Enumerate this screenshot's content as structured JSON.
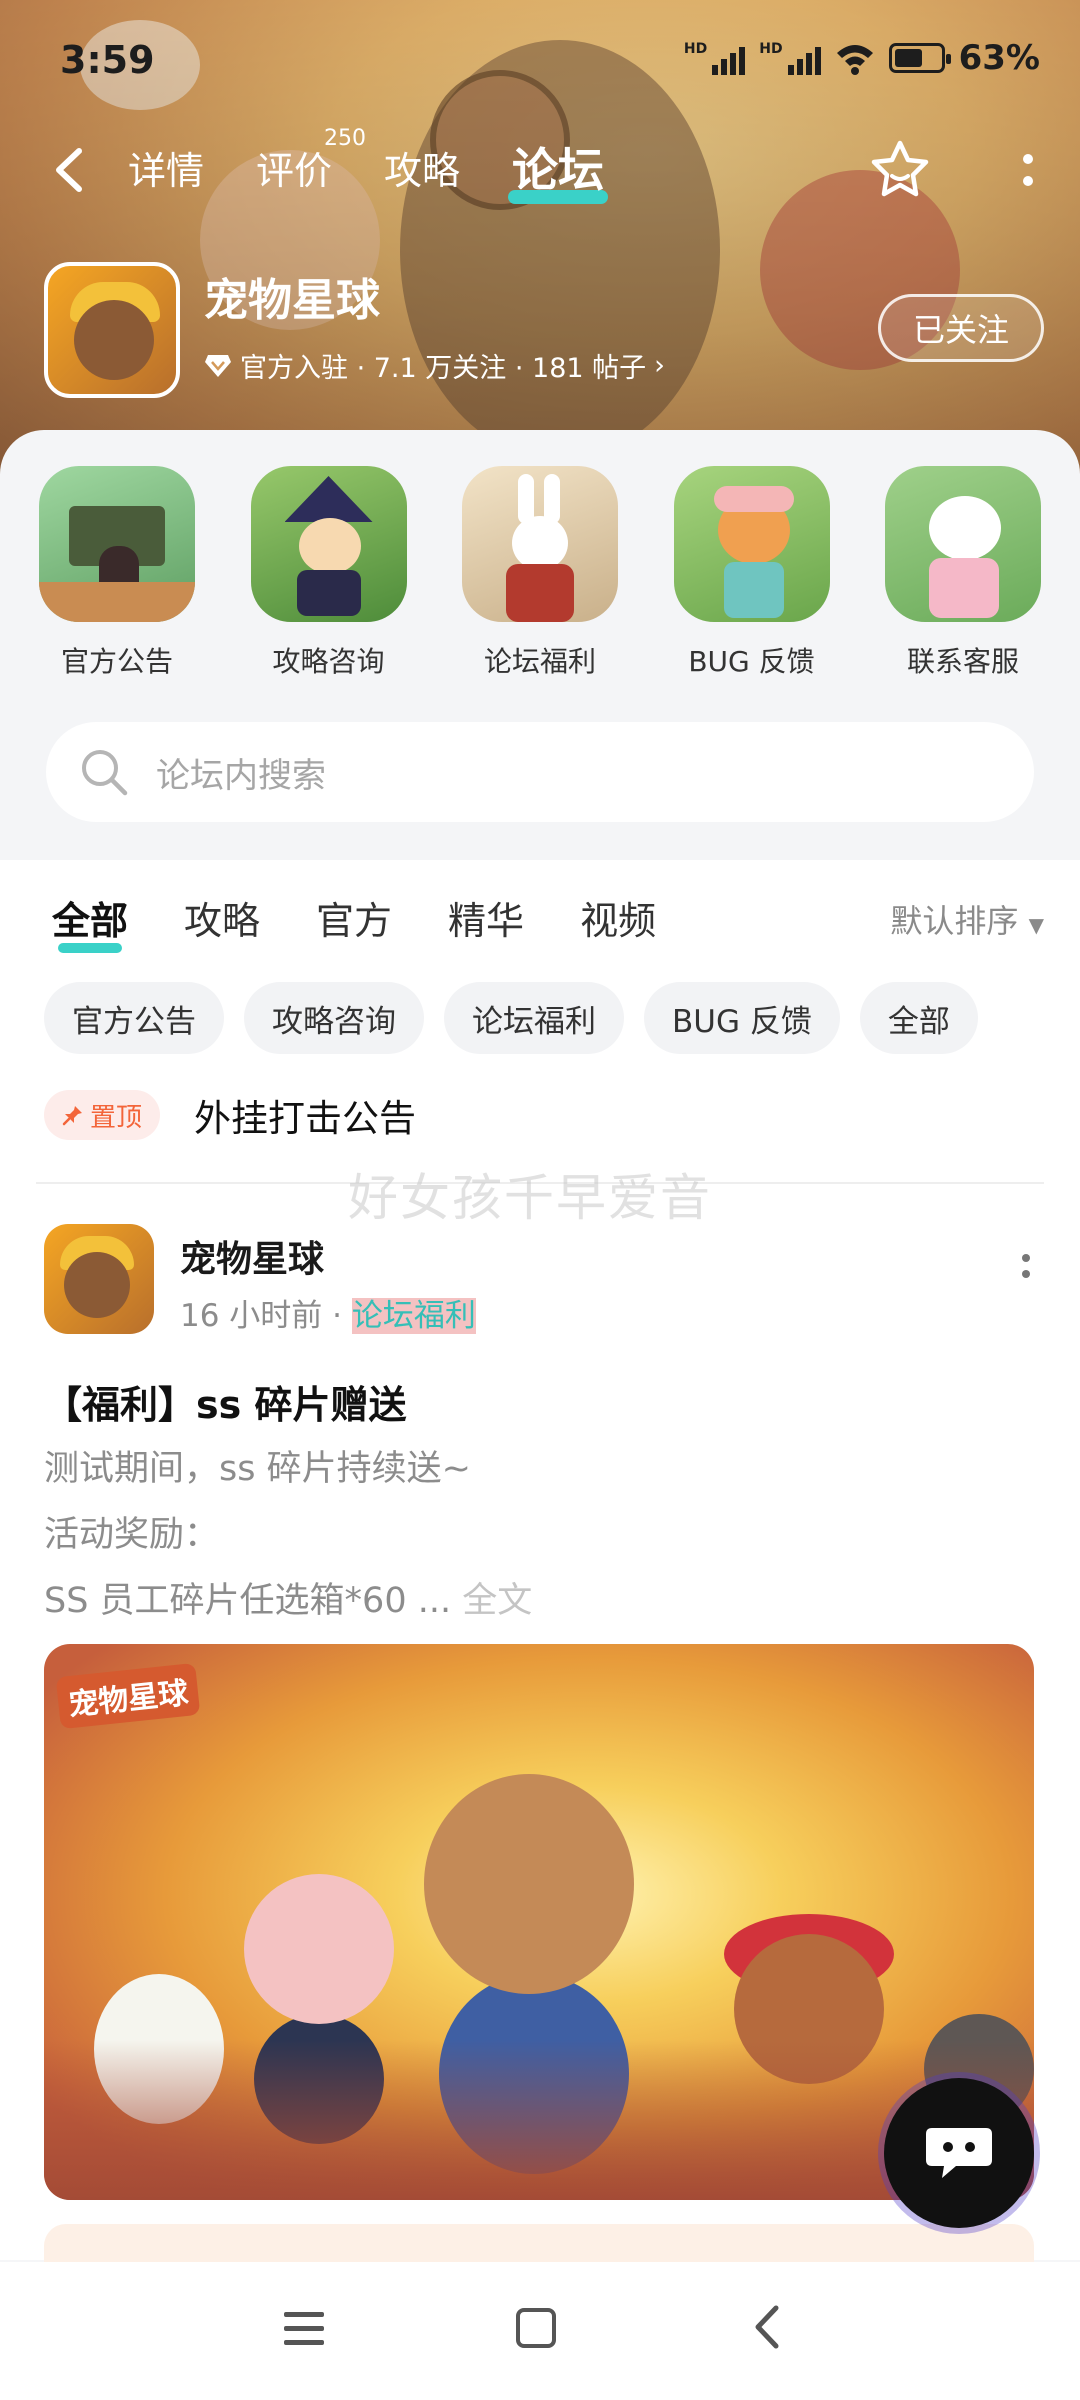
{
  "status_bar": {
    "time": "3:59",
    "battery": "63%"
  },
  "nav": {
    "tabs": [
      {
        "label": "详情"
      },
      {
        "label": "评价",
        "badge": "250"
      },
      {
        "label": "攻略"
      },
      {
        "label": "论坛"
      }
    ],
    "active_tab": "论坛"
  },
  "game": {
    "name": "宠物星球",
    "meta": "官方入驻 · 7.1 万关注 · 181 帖子",
    "follow_label": "已关注"
  },
  "quick_links": [
    {
      "label": "官方公告"
    },
    {
      "label": "攻略咨询"
    },
    {
      "label": "论坛福利"
    },
    {
      "label": "BUG 反馈"
    },
    {
      "label": "联系客服"
    }
  ],
  "search": {
    "placeholder": "论坛内搜索"
  },
  "feed_tabs": [
    {
      "label": "全部"
    },
    {
      "label": "攻略"
    },
    {
      "label": "官方"
    },
    {
      "label": "精华"
    },
    {
      "label": "视频"
    }
  ],
  "sort": {
    "label": "默认排序"
  },
  "chips": [
    {
      "label": "官方公告"
    },
    {
      "label": "攻略咨询"
    },
    {
      "label": "论坛福利"
    },
    {
      "label": "BUG 反馈"
    },
    {
      "label": "全部"
    }
  ],
  "pinned": {
    "tag": "置顶",
    "title": "外挂打击公告"
  },
  "watermark": "好女孩千早爱音",
  "post": {
    "author": "宠物星球",
    "time": "16 小时前",
    "category": "论坛福利",
    "title": "【福利】ss 碎片赠送",
    "lines": [
      "测试期间，ss 碎片持续送~",
      "活动奖励：",
      "SS 员工碎片任选箱*60 ..."
    ],
    "full_text_label": "全文",
    "banner_logo": "宠物星球"
  },
  "colors": {
    "accent": "#3ad1c8",
    "pin": "#f3653a"
  }
}
